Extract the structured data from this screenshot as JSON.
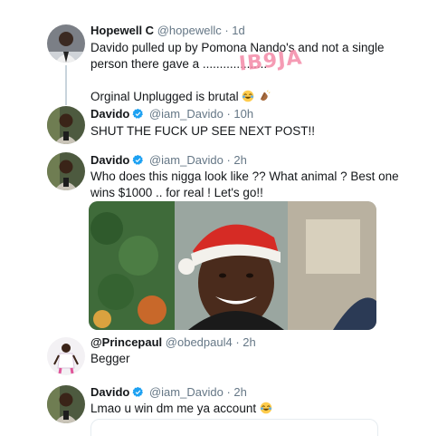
{
  "tweets": [
    {
      "name": "Hopewell C",
      "handle": "@hopewellc",
      "time": "· 1d",
      "lines": [
        "Davido pulled up by Pomona Nando's and not a single",
        "person there gave a ...................",
        "",
        "Orginal Unplugged is brutal"
      ],
      "emoji": [
        "joy-emoji",
        "clap-emoji"
      ]
    },
    {
      "name": "Davido",
      "handle": "@iam_Davido",
      "time": "· 10h",
      "lines": [
        "SHUT THE FUCK UP SEE NEXT POST!!"
      ]
    },
    {
      "name": "Davido",
      "handle": "@iam_Davido",
      "time": "· 2h",
      "lines": [
        "Who does this nigga look like ?? What animal ? Best one",
        "wins $1000 .. for real ! Let's go!!"
      ]
    },
    {
      "name": "@Princepaul",
      "handle": "@obedpaul4",
      "time": "· 2h",
      "lines": [
        "Begger"
      ]
    },
    {
      "name": "Davido",
      "handle": "@iam_Davido",
      "time": "· 2h",
      "lines": [
        "Lmao u win dm me ya account"
      ],
      "emoji": [
        "joy-emoji"
      ]
    }
  ],
  "watermark": "IB9JA",
  "colors": {
    "verified": "#1da1f2",
    "handle": "#657786",
    "thread_line": "#c9d4dc",
    "watermark": "#f48aa8"
  }
}
